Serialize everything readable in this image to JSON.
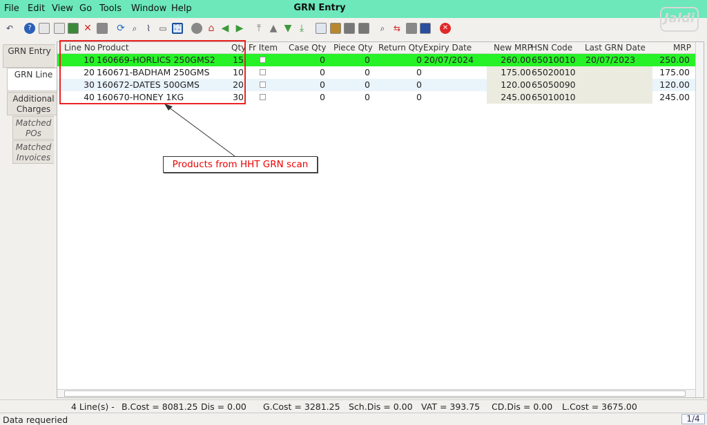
{
  "menu": {
    "file": "File",
    "edit": "Edit",
    "view": "View",
    "go": "Go",
    "tools": "Tools",
    "window": "Window",
    "help": "Help"
  },
  "window_title": "GRN Entry",
  "logo_text": "Jaldi",
  "left_tabs": {
    "grn_entry": "GRN Entry",
    "grn_line": "GRN Line",
    "additional_charges": "Additional Charges",
    "matched_pos": "Matched POs",
    "matched_invoices": "Matched Invoices"
  },
  "grid": {
    "headers": {
      "line_no": "Line No",
      "product": "Product",
      "qty": "Qty",
      "fr_item": "Fr Item",
      "case_qty": "Case Qty",
      "piece_qty": "Piece Qty",
      "return_qty": "Return Qty",
      "expiry_date": "Expiry Date",
      "new_mrp": "New MRP",
      "hsn_code": "HSN Code",
      "last_grn_date": "Last GRN Date",
      "mrp": "MRP"
    },
    "rows": [
      {
        "line_no": "10",
        "product": "160669-HORLICS 250GMS2",
        "qty": "15",
        "case_qty": "0",
        "piece_qty": "0",
        "return_qty": "0",
        "expiry_date": "20/07/2024",
        "new_mrp": "260.00",
        "hsn_code": "65010010",
        "last_grn_date": "20/07/2023",
        "mrp": "250.00"
      },
      {
        "line_no": "20",
        "product": "160671-BADHAM 250GMS",
        "qty": "10",
        "case_qty": "0",
        "piece_qty": "0",
        "return_qty": "0",
        "expiry_date": "",
        "new_mrp": "175.00",
        "hsn_code": "65020010",
        "last_grn_date": "",
        "mrp": "175.00"
      },
      {
        "line_no": "30",
        "product": "160672-DATES 500GMS",
        "qty": "20",
        "case_qty": "0",
        "piece_qty": "0",
        "return_qty": "0",
        "expiry_date": "",
        "new_mrp": "120.00",
        "hsn_code": "65050090",
        "last_grn_date": "",
        "mrp": "120.00"
      },
      {
        "line_no": "40",
        "product": "160670-HONEY 1KG",
        "qty": "30",
        "case_qty": "0",
        "piece_qty": "0",
        "return_qty": "0",
        "expiry_date": "",
        "new_mrp": "245.00",
        "hsn_code": "65010010",
        "last_grn_date": "",
        "mrp": "245.00"
      }
    ]
  },
  "annotation": "Products from HHT GRN scan",
  "summary": {
    "lines": "4 Line(s) -",
    "b_cost": "B.Cost = 8081.25",
    "dis": "Dis = 0.00",
    "g_cost": "G.Cost = 3281.25",
    "sch_dis": "Sch.Dis = 0.00",
    "vat": "VAT = 393.75",
    "cd_dis": "CD.Dis = 0.00",
    "l_cost": "L.Cost = 3675.00"
  },
  "status": {
    "message": "Data requeried",
    "page": "1/4"
  },
  "colors": {
    "menubar": "#6ce8ba",
    "selected_row": "#27f227",
    "annotation": "#e22222"
  }
}
